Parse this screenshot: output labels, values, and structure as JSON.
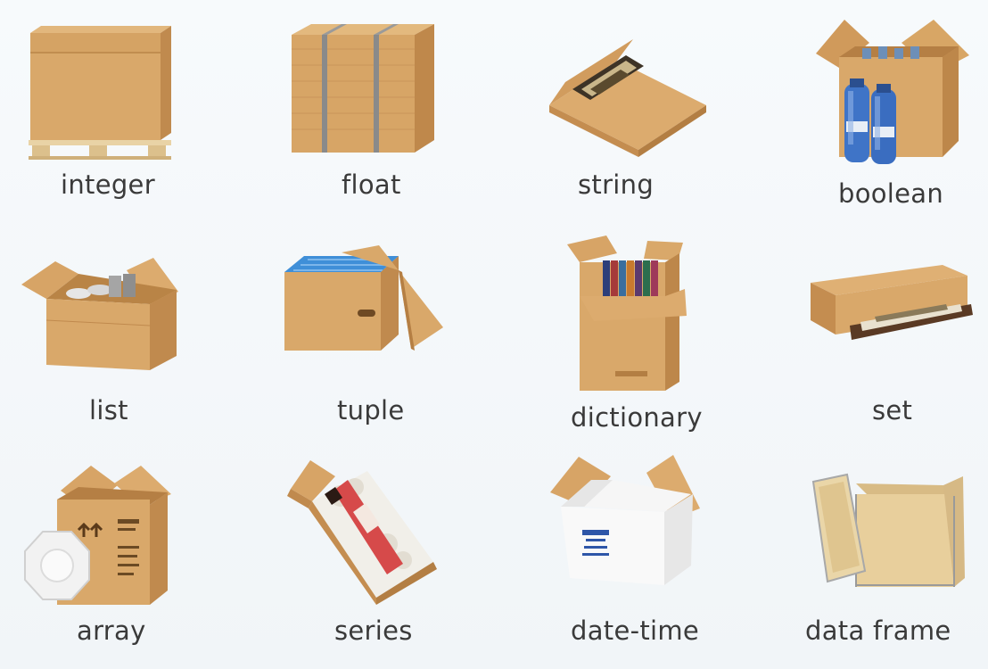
{
  "labels": {
    "integer": "integer",
    "float": "float",
    "string": "string",
    "boolean": "boolean",
    "list": "list",
    "tuple": "tuple",
    "dictionary": "dictionary",
    "set": "set",
    "array": "array",
    "series": "series",
    "date_time": "date-time",
    "data_frame": "data frame"
  },
  "colors": {
    "cardboard": "#d9a86a",
    "cardboard_dark": "#c08a4e",
    "cardboard_light": "#e6bd86",
    "plywood": "#e8cf9c",
    "bottle_blue": "#3f74c7",
    "label_text": "#3a3a3a"
  }
}
